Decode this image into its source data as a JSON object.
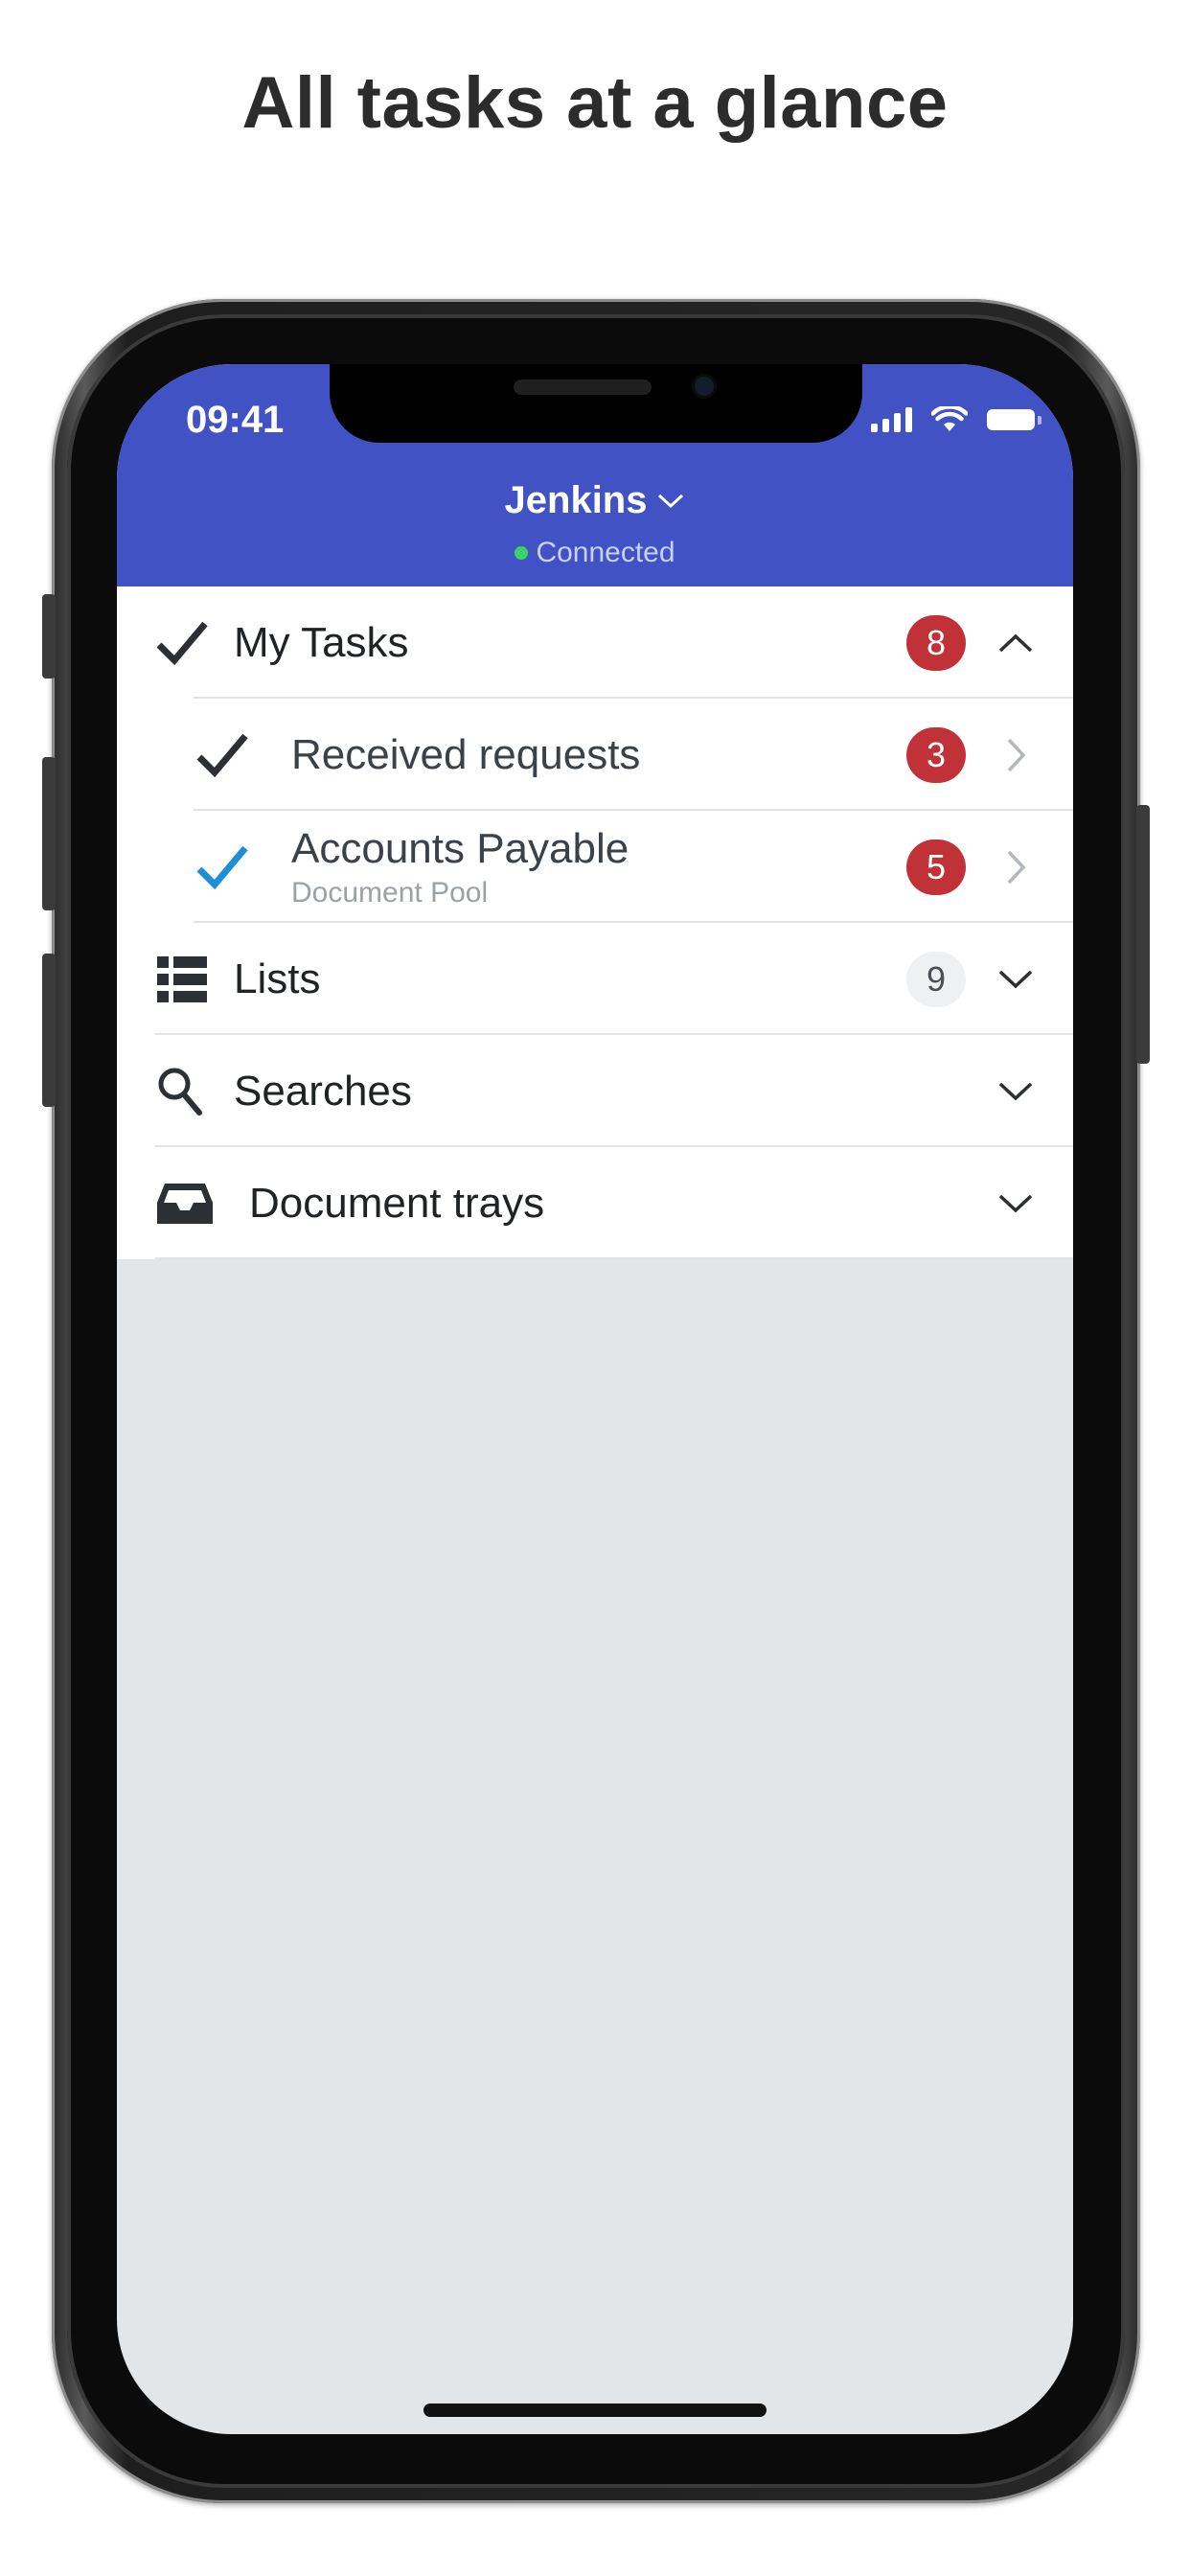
{
  "headline": "All tasks at a glance",
  "status_bar": {
    "time": "09:41",
    "icons": [
      "signal-icon",
      "wifi-icon",
      "battery-icon"
    ]
  },
  "header": {
    "title": "Jenkins",
    "title_icon": "chevron-down-icon",
    "connection_status": "Connected",
    "background": "#4052c4",
    "status_dot_color": "#3cd26a"
  },
  "sections": {
    "my_tasks": {
      "label": "My Tasks",
      "icon": "checkmark-icon",
      "count": "8",
      "expanded": true,
      "toggle_icon": "chevron-up-icon"
    },
    "received_requests": {
      "label": "Received requests",
      "icon": "checkmark-icon",
      "count": "3",
      "trail_icon": "chevron-right-icon"
    },
    "accounts_payable": {
      "label": "Accounts Payable",
      "sublabel": "Document Pool",
      "icon": "checkmark-icon",
      "icon_color": "#1e8fd6",
      "count": "5",
      "trail_icon": "chevron-right-icon"
    },
    "lists": {
      "label": "Lists",
      "icon": "list-icon",
      "count": "9",
      "toggle_icon": "chevron-down-icon"
    },
    "searches": {
      "label": "Searches",
      "icon": "search-icon",
      "toggle_icon": "chevron-down-icon"
    },
    "document_trays": {
      "label": "Document trays",
      "icon": "inbox-tray-icon",
      "toggle_icon": "chevron-down-icon"
    }
  },
  "colors": {
    "badge_red": "#c03237",
    "badge_grey": "#eef0f2",
    "content_background": "#e3e6e9"
  }
}
